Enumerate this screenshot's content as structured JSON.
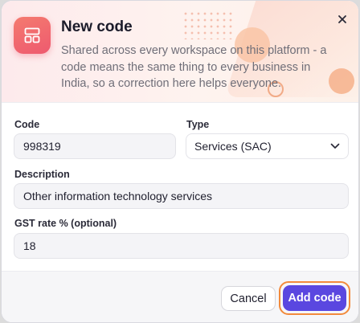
{
  "dialog": {
    "title": "New code",
    "subtitle": "Shared across every workspace on this platform - a code means the same thing to every business in India, so a correction here helps everyone."
  },
  "form": {
    "code": {
      "label": "Code",
      "value": "998319"
    },
    "type": {
      "label": "Type",
      "selected": "Services (SAC)"
    },
    "description": {
      "label": "Description",
      "value": "Other information technology services"
    },
    "gst_rate": {
      "label": "GST rate % (optional)",
      "value": "18"
    }
  },
  "actions": {
    "cancel_label": "Cancel",
    "add_label": "Add code"
  },
  "colors": {
    "accent": "#5a47e0",
    "focus_ring": "#f28a3c",
    "icon_gradient_start": "#f47a6f",
    "icon_gradient_end": "#ee5a6f"
  },
  "icons": {
    "header": "layout-grid-icon",
    "close": "close-icon",
    "select_arrow": "chevron-down-icon"
  }
}
